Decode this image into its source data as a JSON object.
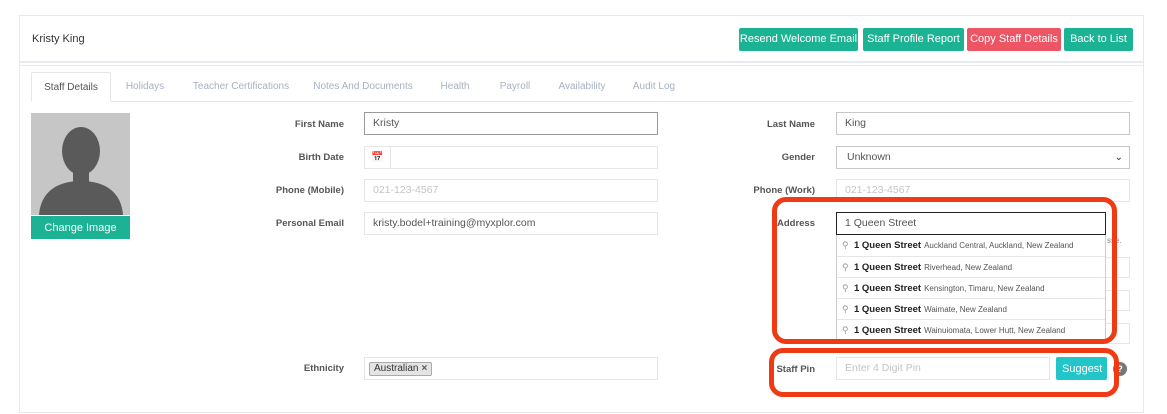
{
  "header": {
    "staff_name": "Kristy King",
    "buttons": {
      "resend": "Resend Welcome Email",
      "profile_report": "Staff Profile Report",
      "copy_details": "Copy Staff Details",
      "back": "Back to List"
    }
  },
  "colors": {
    "accent": "#1bb394",
    "danger": "#ed5565",
    "info": "#23c6c8",
    "highlight": "#f03a14"
  },
  "tabs": [
    {
      "label": "Staff Details",
      "active": true
    },
    {
      "label": "Holidays"
    },
    {
      "label": "Teacher Certifications"
    },
    {
      "label": "Notes And Documents"
    },
    {
      "label": "Health"
    },
    {
      "label": "Payroll"
    },
    {
      "label": "Availability"
    },
    {
      "label": "Audit Log"
    }
  ],
  "profile": {
    "change_image": "Change Image"
  },
  "form": {
    "first_name": {
      "label": "First Name",
      "value": "Kristy"
    },
    "last_name": {
      "label": "Last Name",
      "value": "King"
    },
    "birth_date": {
      "label": "Birth Date",
      "value": "",
      "icon": "calendar-icon"
    },
    "gender": {
      "label": "Gender",
      "value": "Unknown"
    },
    "phone_mobile": {
      "label": "Phone (Mobile)",
      "placeholder": "021-123-4567"
    },
    "phone_work": {
      "label": "Phone (Work)",
      "placeholder": "021-123-4567"
    },
    "personal_email": {
      "label": "Personal Email",
      "value": "kristy.bodel+training@myxplor.com"
    },
    "address": {
      "label": "Address",
      "value": "1 Queen Street"
    },
    "ethnicity": {
      "label": "Ethnicity",
      "tag": "Australian"
    },
    "staff_pin": {
      "label": "Staff Pin",
      "placeholder": "Enter 4 Digit Pin",
      "suggest": "Suggest"
    }
  },
  "address_suggestions": [
    {
      "main": "1 Queen Street",
      "secondary": "Auckland Central, Auckland, New Zealand"
    },
    {
      "main": "1 Queen Street",
      "secondary": "Riverhead, New Zealand"
    },
    {
      "main": "1 Queen Street",
      "secondary": "Kensington, Timaru, New Zealand"
    },
    {
      "main": "1 Queen Street",
      "secondary": "Waimate, New Zealand"
    },
    {
      "main": "1 Queen Street",
      "secondary": "Wainuiomata, Lower Hutt, New Zealand"
    }
  ],
  "background_fragment": "sse."
}
